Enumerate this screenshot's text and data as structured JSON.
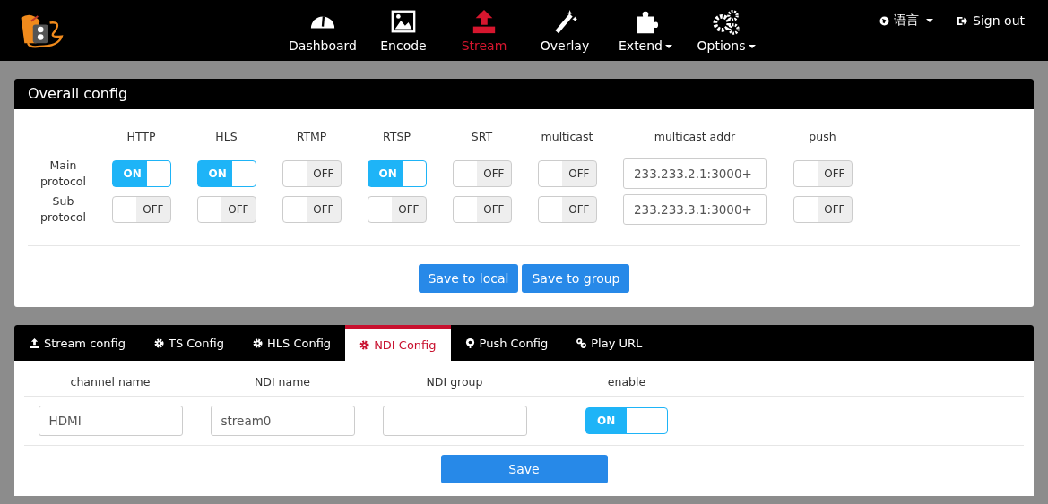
{
  "nav": {
    "items": [
      {
        "label": "Dashboard",
        "selected": false,
        "dropdown": false
      },
      {
        "label": "Encode",
        "selected": false,
        "dropdown": false
      },
      {
        "label": "Stream",
        "selected": true,
        "dropdown": false
      },
      {
        "label": "Overlay",
        "selected": false,
        "dropdown": false
      },
      {
        "label": "Extend",
        "selected": false,
        "dropdown": true
      },
      {
        "label": "Options",
        "selected": false,
        "dropdown": true
      }
    ],
    "language": "语言",
    "sign_out": "Sign out"
  },
  "overall": {
    "title": "Overall config",
    "columns": [
      "HTTP",
      "HLS",
      "RTMP",
      "RTSP",
      "SRT",
      "multicast",
      "multicast addr",
      "push"
    ],
    "rows": [
      {
        "label": "Main protocol",
        "cells": [
          {
            "kind": "switch",
            "on": true,
            "label": "ON"
          },
          {
            "kind": "switch",
            "on": true,
            "label": "ON"
          },
          {
            "kind": "switch",
            "on": false,
            "label": "OFF"
          },
          {
            "kind": "switch",
            "on": true,
            "label": "ON"
          },
          {
            "kind": "switch",
            "on": false,
            "label": "OFF"
          },
          {
            "kind": "switch",
            "on": false,
            "label": "OFF"
          },
          {
            "kind": "field",
            "value": "233.233.2.1:3000+"
          },
          {
            "kind": "switch",
            "on": false,
            "label": "OFF"
          }
        ]
      },
      {
        "label": "Sub protocol",
        "cells": [
          {
            "kind": "switch",
            "on": false,
            "label": "OFF"
          },
          {
            "kind": "switch",
            "on": false,
            "label": "OFF"
          },
          {
            "kind": "switch",
            "on": false,
            "label": "OFF"
          },
          {
            "kind": "switch",
            "on": false,
            "label": "OFF"
          },
          {
            "kind": "switch",
            "on": false,
            "label": "OFF"
          },
          {
            "kind": "switch",
            "on": false,
            "label": "OFF"
          },
          {
            "kind": "field",
            "value": "233.233.3.1:3000+"
          },
          {
            "kind": "switch",
            "on": false,
            "label": "OFF"
          }
        ]
      }
    ],
    "buttons": [
      "Save to local",
      "Save to group"
    ]
  },
  "tabs": [
    {
      "label": "Stream config",
      "selected": false
    },
    {
      "label": "TS Config",
      "selected": false
    },
    {
      "label": "HLS Config",
      "selected": false
    },
    {
      "label": "NDI Config",
      "selected": true
    },
    {
      "label": "Push Config",
      "selected": false
    },
    {
      "label": "Play URL",
      "selected": false
    }
  ],
  "ndi": {
    "columns": [
      "channel name",
      "NDI name",
      "NDI group",
      "enable"
    ],
    "cells": [
      {
        "kind": "field",
        "value": "HDMI"
      },
      {
        "kind": "field",
        "value": "stream0"
      },
      {
        "kind": "field"
      },
      {
        "kind": "switch",
        "on": true,
        "label": "ON"
      }
    ],
    "button": "Save"
  }
}
